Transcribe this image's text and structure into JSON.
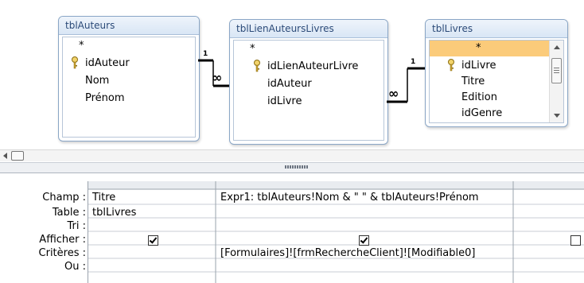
{
  "tables": [
    {
      "name": "tblAuteurs",
      "fields": [
        "*",
        "idAuteur",
        "Nom",
        "Prénom"
      ]
    },
    {
      "name": "tblLienAuteursLivres",
      "fields": [
        "*",
        "idLienAuteurLivre",
        "idAuteur",
        "idLivre"
      ]
    },
    {
      "name": "tblLivres",
      "fields": [
        "*",
        "idLivre",
        "Titre",
        "Edition",
        "idGenre"
      ]
    }
  ],
  "relations": [
    {
      "one": "1",
      "many": "∞"
    },
    {
      "one": "1",
      "many": "∞"
    }
  ],
  "grid": {
    "row_labels": [
      "Champ :",
      "Table :",
      "Tri :",
      "Afficher :",
      "Critères :",
      "Ou :"
    ],
    "columns": [
      {
        "champ": "Titre",
        "table": "tblLivres",
        "tri": "",
        "afficher": true,
        "criteres": ""
      },
      {
        "champ": "Expr1: tblAuteurs!Nom & \" \" & tblAuteurs!Prénom",
        "table": "",
        "tri": "",
        "afficher": true,
        "criteres": "[Formulaires]![frmRechercheClient]![Modifiable0]"
      },
      {
        "champ": "",
        "table": "",
        "tri": "",
        "afficher": false,
        "criteres": ""
      }
    ]
  },
  "colors": {
    "table_title": "#2b4a78",
    "selected_row": "#fbcb7a",
    "table_border": "#8aa6c6"
  }
}
